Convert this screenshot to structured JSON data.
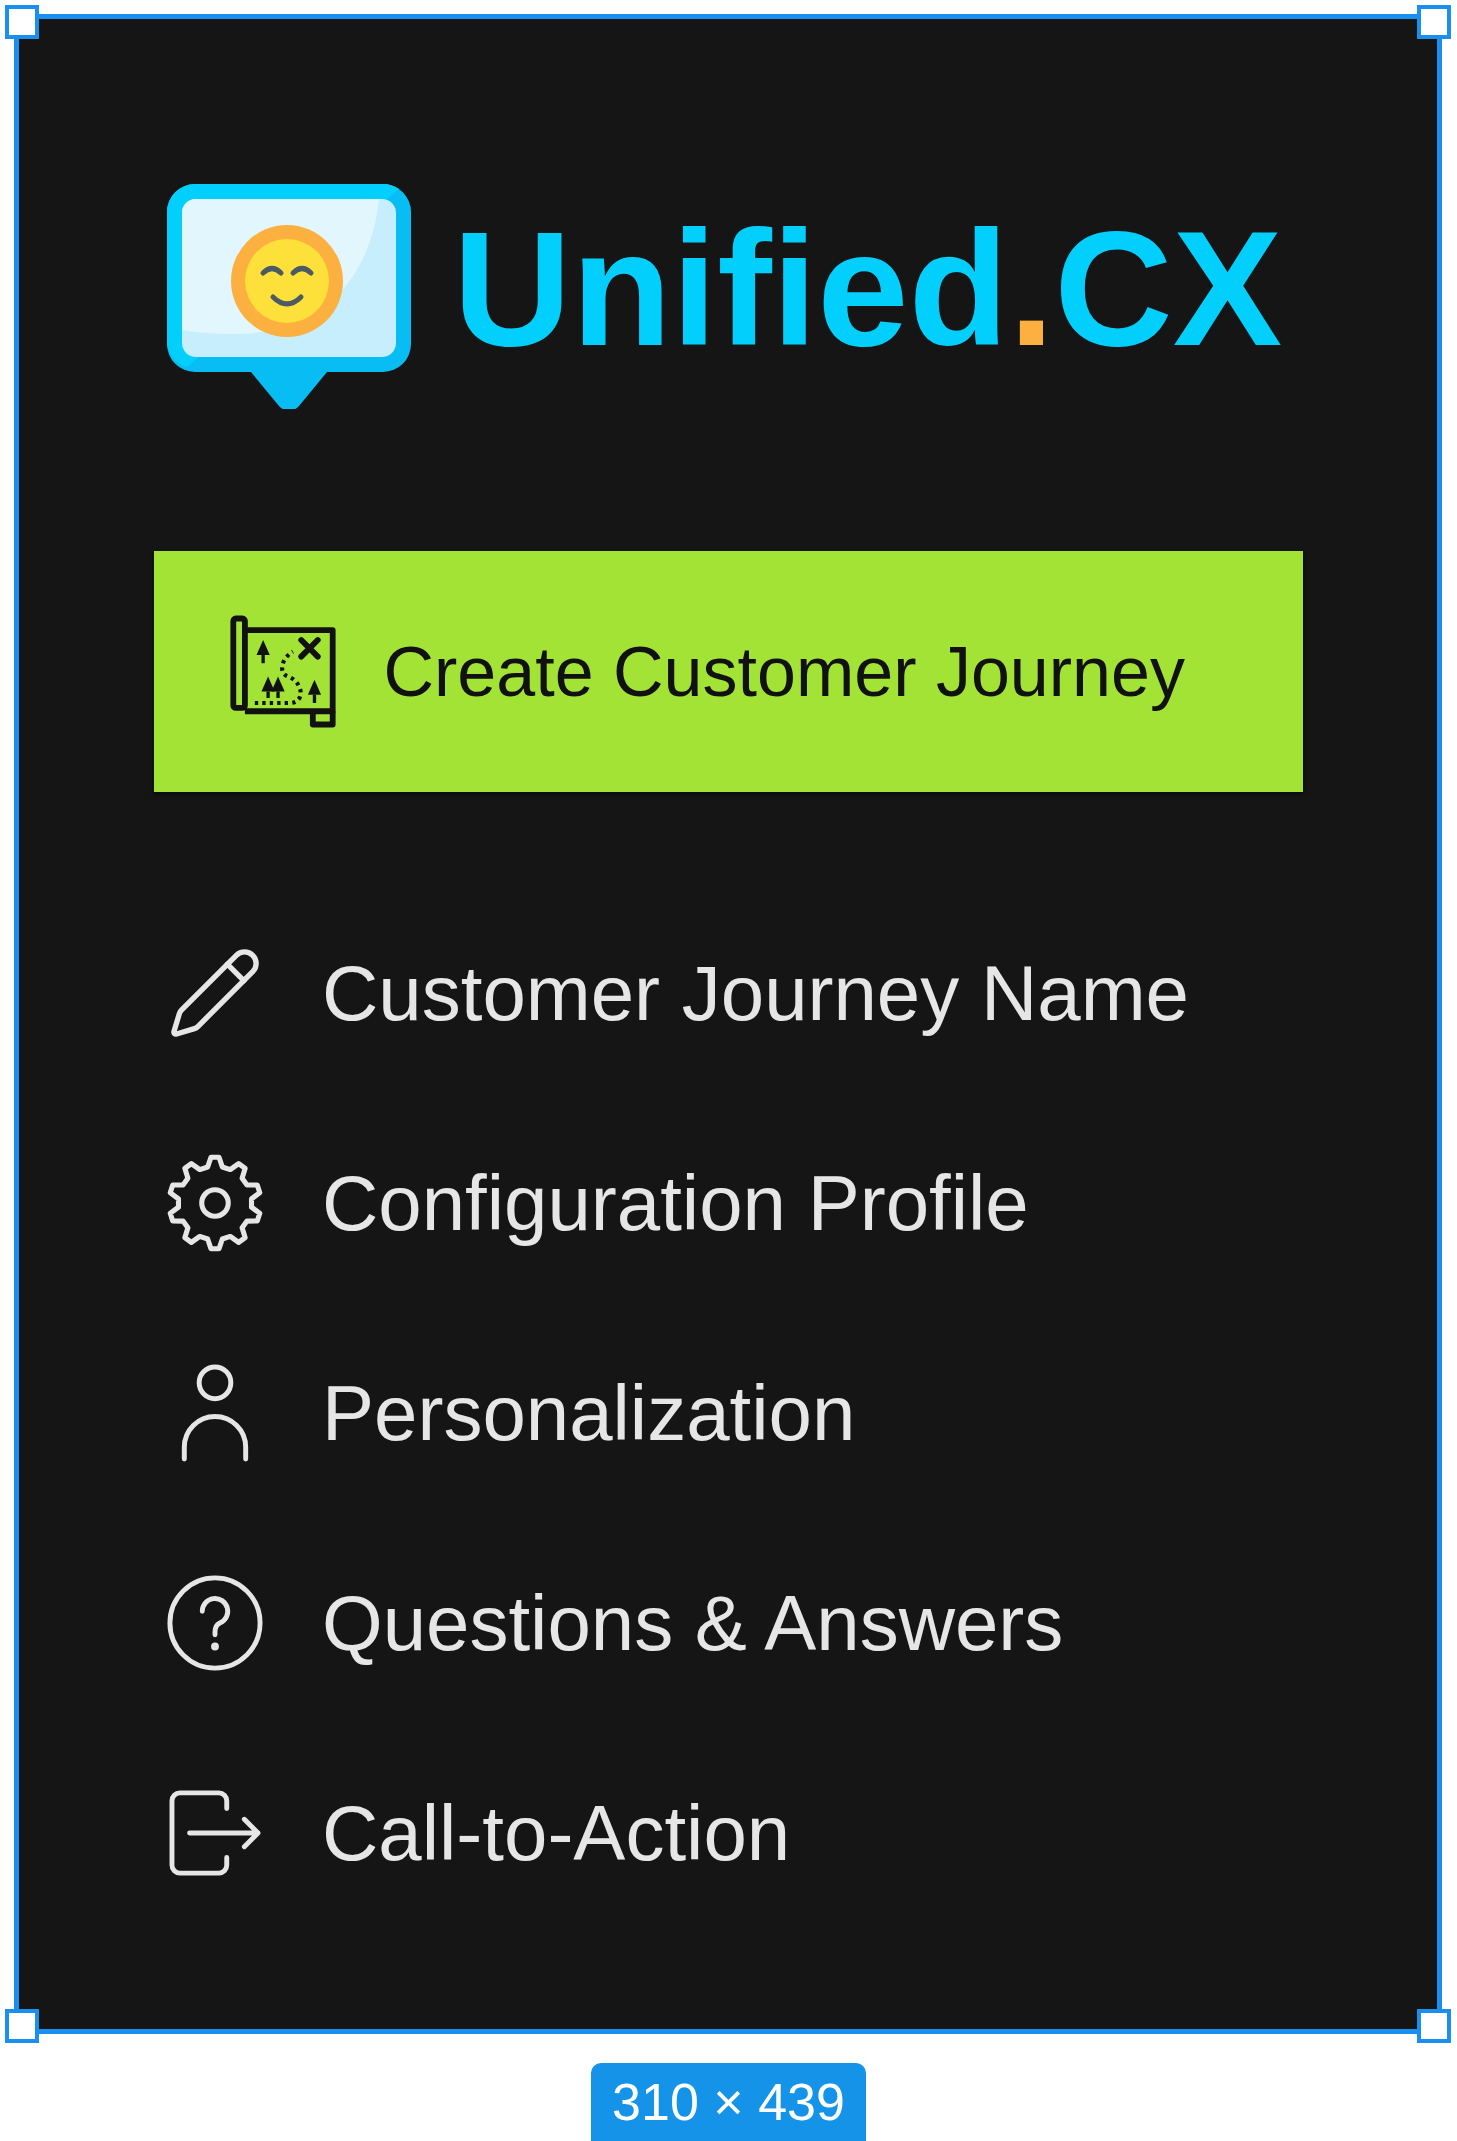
{
  "logo": {
    "parts": [
      {
        "text": "Unified",
        "color": "#03cffc"
      },
      {
        "text": ".",
        "color": "#fbb040"
      },
      {
        "text": "CX",
        "color": "#03cffc"
      }
    ]
  },
  "primary_button": {
    "label": "Create Customer Journey"
  },
  "menu": {
    "items": [
      {
        "label": "Customer Journey Name"
      },
      {
        "label": "Configuration Profile"
      },
      {
        "label": "Personalization"
      },
      {
        "label": "Questions & Answers"
      },
      {
        "label": "Call-to-Action"
      }
    ]
  },
  "selection": {
    "size_label": "310 × 439"
  }
}
